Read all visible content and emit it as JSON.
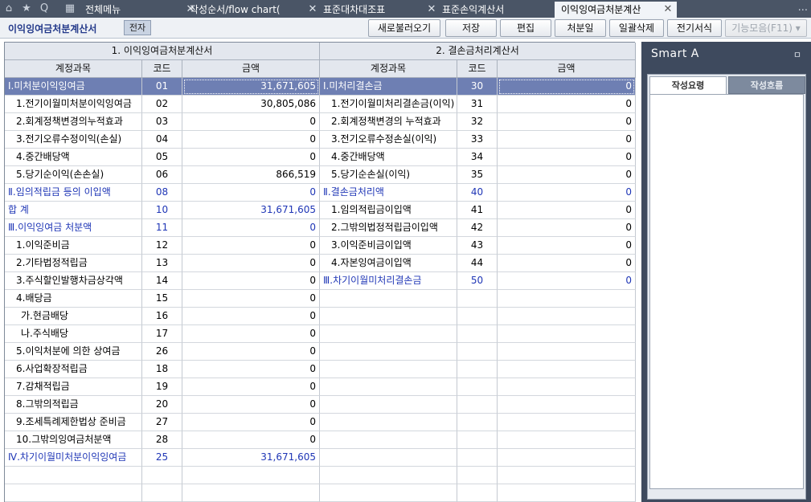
{
  "tabbar": {
    "icons": {
      "home": "⌂",
      "star": "★",
      "search": "Q",
      "calendar": "▦"
    },
    "tabs": [
      {
        "label": "전체메뉴",
        "closable": false
      },
      {
        "label": "작성순서/flow chart(",
        "closable": true
      },
      {
        "label": "표준대차대조표",
        "closable": true
      },
      {
        "label": "표준손익계산서",
        "closable": true
      },
      {
        "label": "이익잉여금처분계산",
        "closable": true,
        "active": true
      }
    ],
    "close_glyph": "✕",
    "more": "..."
  },
  "toolbar": {
    "title": "이익잉여금처분계산서",
    "tag": "전자",
    "buttons": [
      "새로불러오기",
      "저장",
      "편집",
      "처분일",
      "일괄삭제",
      "전기서식",
      "기능모음(F11)"
    ],
    "dropdown_glyph": "▾"
  },
  "grid": {
    "left": {
      "section_title": "1. 이익잉여금처분계산서",
      "headers": {
        "account": "계정과목",
        "code": "코드",
        "amount": "금액"
      },
      "rows": [
        {
          "account": "Ⅰ.미처분이익잉여금",
          "code": "01",
          "amount": "31,671,605",
          "selected": true
        },
        {
          "account": "1.전기이월미처분이익잉여금",
          "code": "02",
          "amount": "30,805,086"
        },
        {
          "account": "2.회계정책변경의누적효과",
          "code": "03",
          "amount": "0"
        },
        {
          "account": "3.전기오류수정이익(손실)",
          "code": "04",
          "amount": "0"
        },
        {
          "account": "4.중간배당액",
          "code": "05",
          "amount": "0"
        },
        {
          "account": "5.당기순이익(손손실)",
          "code": "06",
          "amount": "866,519"
        },
        {
          "account": "Ⅱ.임의적립금 등의 이입액",
          "code": "08",
          "amount": "0",
          "blue": true
        },
        {
          "account": "합             계",
          "code": "10",
          "amount": "31,671,605",
          "blue": true
        },
        {
          "account": "Ⅲ.이익잉여금 처분액",
          "code": "11",
          "amount": "0",
          "blue": true
        },
        {
          "account": "1.이익준비금",
          "code": "12",
          "amount": "0"
        },
        {
          "account": "2.기타법정적립금",
          "code": "13",
          "amount": "0"
        },
        {
          "account": "3.주식할인발행차금상각액",
          "code": "14",
          "amount": "0"
        },
        {
          "account": "4.배당금",
          "code": "15",
          "amount": "0"
        },
        {
          "account": "가.현금배당",
          "code": "16",
          "amount": "0",
          "indent": true
        },
        {
          "account": "나.주식배당",
          "code": "17",
          "amount": "0",
          "indent": true
        },
        {
          "account": "5.이익처분에 의한 상여금",
          "code": "26",
          "amount": "0"
        },
        {
          "account": "6.사업확장적립금",
          "code": "18",
          "amount": "0"
        },
        {
          "account": "7.감채적립금",
          "code": "19",
          "amount": "0"
        },
        {
          "account": "8.그밖의적립금",
          "code": "20",
          "amount": "0"
        },
        {
          "account": "9.조세특례제한법상 준비금",
          "code": "27",
          "amount": "0"
        },
        {
          "account": "10.그밖의잉여금처분액",
          "code": "28",
          "amount": "0"
        },
        {
          "account": "Ⅳ.차기이월미처분이익잉여금",
          "code": "25",
          "amount": "31,671,605",
          "blue": true
        }
      ]
    },
    "right": {
      "section_title": "2. 결손금처리계산서",
      "headers": {
        "account": "계정과목",
        "code": "코드",
        "amount": "금액"
      },
      "rows": [
        {
          "account": "Ⅰ.미처리결손금",
          "code": "30",
          "amount": "0",
          "selected": true
        },
        {
          "account": "1.전기이월미처리결손금(이익)",
          "code": "31",
          "amount": "0"
        },
        {
          "account": "2.회계정책변경의 누적효과",
          "code": "32",
          "amount": "0"
        },
        {
          "account": "3.전기오류수정손실(이익)",
          "code": "33",
          "amount": "0"
        },
        {
          "account": "4.중간배당액",
          "code": "34",
          "amount": "0"
        },
        {
          "account": "5.당기순손실(이익)",
          "code": "35",
          "amount": "0"
        },
        {
          "account": "Ⅱ.결손금처리액",
          "code": "40",
          "amount": "0",
          "blue": true
        },
        {
          "account": "1.임의적립금이입액",
          "code": "41",
          "amount": "0"
        },
        {
          "account": "2.그밖의법정적립금이입액",
          "code": "42",
          "amount": "0"
        },
        {
          "account": "3.이익준비금이입액",
          "code": "43",
          "amount": "0"
        },
        {
          "account": "4.자본잉여금이입액",
          "code": "44",
          "amount": "0"
        },
        {
          "account": "Ⅲ.차기이월미처리결손금",
          "code": "50",
          "amount": "0",
          "blue": true
        }
      ]
    }
  },
  "smart_panel": {
    "title": "Smart A",
    "pin": "ㅁ",
    "tabs": [
      {
        "label": "작성요령",
        "active": true
      },
      {
        "label": "작성흐름",
        "active": false
      }
    ]
  }
}
